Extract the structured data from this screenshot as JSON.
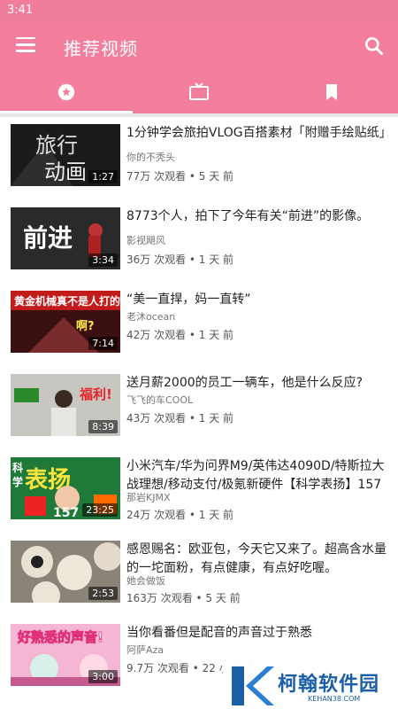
{
  "status_bar": {
    "time": "3:41"
  },
  "app_bar": {
    "title": "推荐视频"
  },
  "tabs": [
    {
      "icon": "star-badge-icon",
      "active": true
    },
    {
      "icon": "tv-icon",
      "active": false
    },
    {
      "icon": "bookmark-icon",
      "active": false
    }
  ],
  "videos": [
    {
      "title": "1分钟学会旅拍VLOG百搭素材「附赠手绘贴纸」",
      "author": "你的不秃头",
      "meta": "77万 次观看 • 5 天 前",
      "duration": "1:27",
      "thumb_text": "旅行动画"
    },
    {
      "title": "8773个人，拍下了今年有关“前进”的影像。",
      "author": "影视飓风",
      "meta": "36万 次观看 • 1 天 前",
      "duration": "3:34",
      "thumb_text": "前进"
    },
    {
      "title": "“美一直捍，妈一直转”",
      "author": "老沐ocean",
      "meta": "42万 次观看 • 1 天 前",
      "duration": "7:14",
      "thumb_text": "黄金机械真不是人打的"
    },
    {
      "title": "送月薪2000的员工一辆车，他是什么反应?",
      "author": "飞飞的车COOL",
      "meta": "43万 次观看 • 1 天 前",
      "duration": "8:39",
      "thumb_text": "福利!"
    },
    {
      "title": "小米汽车/华为问界M9/英伟达4090D/特斯拉大战理想/移动支付/极氪新硬件【科学表扬】157",
      "author": "那岩KJMX",
      "meta": "24万 次观看 • 1 天 前",
      "duration": "23:25",
      "thumb_text": "科学表扬"
    },
    {
      "title": "感恩赐名：欧亚包，今天它又来了。超高含水量的一坨面粉，有点健康，有点好吃喔。",
      "author": "她会做饭",
      "meta": "163万 次观看 • 5 天 前",
      "duration": "2:53",
      "thumb_text": ""
    },
    {
      "title": "当你看番但是配音的声音过于熟悉",
      "author": "阿萨Aza",
      "meta": "9.7万 次观看 • 22 小时 前",
      "duration": "3:00",
      "thumb_text": "好熟悉的声音!"
    }
  ],
  "watermark": {
    "text": "柯翰软件园",
    "sub": "KEHAN38.COM"
  },
  "colors": {
    "primary": "#f47f9d",
    "status": "#f07d9b"
  }
}
